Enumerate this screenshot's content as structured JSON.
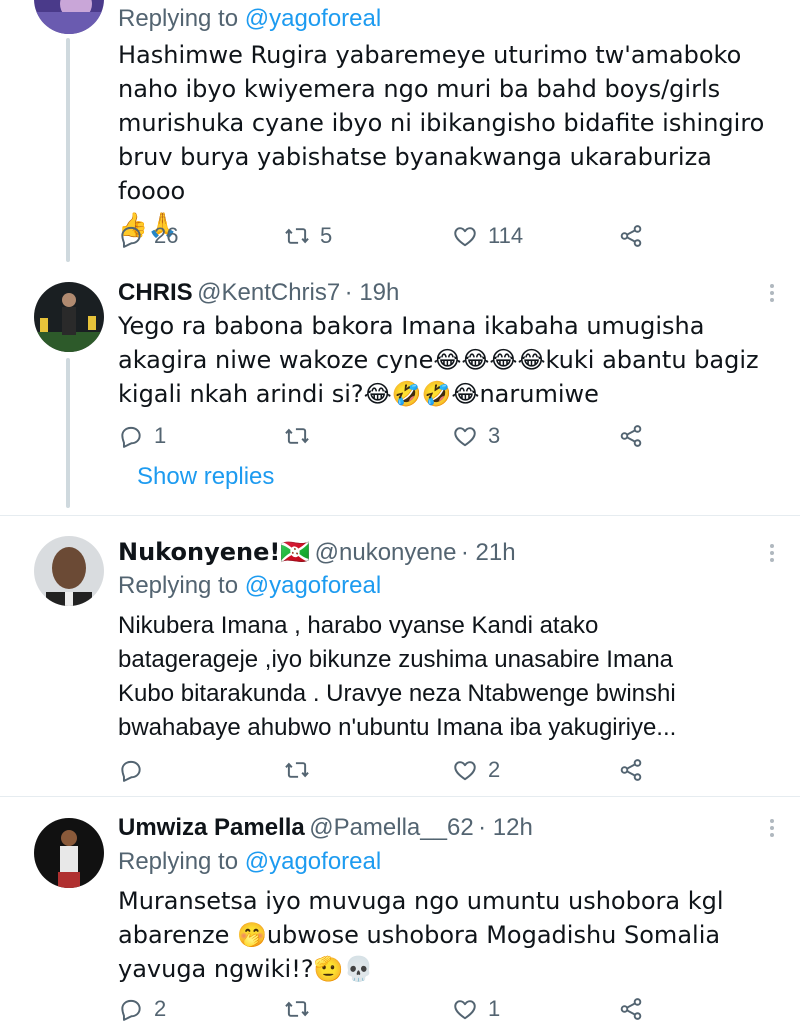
{
  "top_tweet": {
    "replying_prefix": "Replying to",
    "replying_to": "@yagoforeal",
    "text": "Hashimwe Rugira yabaremeye uturimo tw'amaboko\nnaho ibyo kwiyemera ngo muri ba bahd boys/girls\nmurishuka cyane ibyo ni ibikangisho bidafite ishingiro\nbruv burya yabishatse byanakwanga ukaraburiza foooo\n👍🙏",
    "replies": "26",
    "retweets": "5",
    "likes": "114"
  },
  "tweet_chris": {
    "name": "CHRIS",
    "handle": "@KentChris7",
    "time": "· 19h",
    "text": "Yego ra babona bakora Imana ikabaha umugisha\nakagira niwe wakoze cyne😂😂😂😂kuki abantu bagiz\nkigali nkah arindi si?😂🤣🤣😂narumiwe",
    "replies": "1",
    "retweets": "",
    "likes": "3",
    "show_replies": "Show replies"
  },
  "tweet_nukonyene": {
    "name": "Nukonyene!🇧🇮",
    "handle": "@nukonyene",
    "time": "· 21h",
    "replying_prefix": "Replying to",
    "replying_to": "@yagoforeal",
    "text": "Nikubera Imana , harabo vyanse Kandi atako\nbatageragejе ,iyo bikunze zushima unasabire Imana\nKubo bitarakunda . Uravye neza Ntabwenge bwinshi\nbwahabaye ahubwo n'ubuntu Imana iba yakugiriye...",
    "replies": "",
    "retweets": "",
    "likes": "2"
  },
  "tweet_pamella": {
    "name": "Umwiza Pamella",
    "handle": "@Pamella__62",
    "time": "· 12h",
    "replying_prefix": "Replying to",
    "replying_to": "@yagoforeal",
    "text": "Muransetsa iyo muvuga ngo umuntu ushobora kgl\nabarenze 🤭ubwose ushobora Mogadishu Somalia\nyavuga ngwiki!?🫡💀",
    "replies": "2",
    "retweets": "",
    "likes": "1"
  },
  "icons": {
    "reply": "reply-icon",
    "retweet": "retweet-icon",
    "like": "heart-icon",
    "share": "share-icon",
    "more": "more-icon"
  },
  "colors": {
    "link": "#1d9bf0",
    "secondary_text": "#536471",
    "divider": "#e6ecf0",
    "thread_line": "#cfd9de"
  }
}
